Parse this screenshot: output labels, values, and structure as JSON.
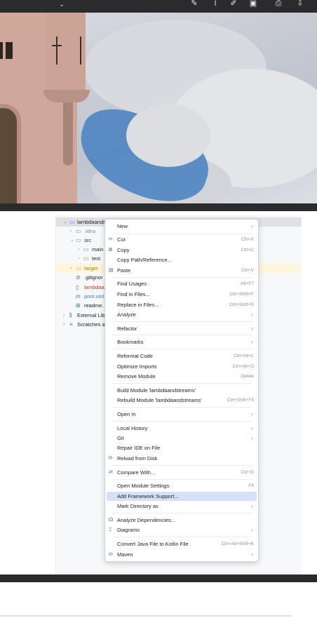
{
  "viewer_toolbar": {
    "tools": [
      "highlight-icon",
      "text-icon",
      "draw-icon",
      "image-icon",
      "print-icon",
      "save-icon"
    ]
  },
  "project_tree": {
    "rows": [
      {
        "label": "lambdaands"
      },
      {
        "label": ".idea"
      },
      {
        "label": "src"
      },
      {
        "label": "main"
      },
      {
        "label": "test"
      },
      {
        "label": "target"
      },
      {
        "label": ".gitignor"
      },
      {
        "label": "lambdaa"
      },
      {
        "label": "pom.xml"
      },
      {
        "label": "readme."
      },
      {
        "label": "External Libr"
      },
      {
        "label": "Scratches a"
      }
    ]
  },
  "context_menu": {
    "items": {
      "new": {
        "label": "New"
      },
      "cut": {
        "label": "Cut",
        "shortcut": "Ctrl+X"
      },
      "copy": {
        "label": "Copy",
        "shortcut": "Ctrl+C"
      },
      "copy_path": {
        "label": "Copy Path/Reference..."
      },
      "paste": {
        "label": "Paste",
        "shortcut": "Ctrl+V"
      },
      "find_usages": {
        "label": "Find Usages",
        "shortcut": "Alt+F7"
      },
      "find_in_files": {
        "label": "Find in Files...",
        "shortcut": "Ctrl+Shift+F"
      },
      "replace_in_files": {
        "label": "Replace in Files...",
        "shortcut": "Ctrl+Shift+R"
      },
      "analyze": {
        "label": "Analyze"
      },
      "refactor": {
        "label": "Refactor"
      },
      "bookmarks": {
        "label": "Bookmarks"
      },
      "reformat_code": {
        "label": "Reformat Code",
        "shortcut": "Ctrl+Alt+L"
      },
      "optimize_imports": {
        "label": "Optimize Imports",
        "shortcut": "Ctrl+Alt+O"
      },
      "remove_module": {
        "label": "Remove Module",
        "shortcut": "Delete"
      },
      "build_module": {
        "label": "Build Module 'lambdaandstreams'"
      },
      "rebuild_module": {
        "label": "Rebuild Module 'lambdaandstreams'",
        "shortcut": "Ctrl+Shift+F9"
      },
      "open_in": {
        "label": "Open In"
      },
      "local_history": {
        "label": "Local History"
      },
      "git": {
        "label": "Git"
      },
      "repair_ide": {
        "label": "Repair IDE on File"
      },
      "reload_from_disk": {
        "label": "Reload from Disk"
      },
      "compare_with": {
        "label": "Compare With...",
        "shortcut": "Ctrl+D"
      },
      "open_module_settings": {
        "label": "Open Module Settings",
        "shortcut": "F4"
      },
      "add_framework_support": {
        "label": "Add Framework Support..."
      },
      "mark_directory_as": {
        "label": "Mark Directory as"
      },
      "analyze_dependencies": {
        "label": "Analyze Dependencies..."
      },
      "diagrams": {
        "label": "Diagrams"
      },
      "convert_java_kotlin": {
        "label": "Convert Java File to Kotlin File",
        "shortcut": "Ctrl+Alt+Shift+K"
      },
      "maven": {
        "label": "Maven"
      }
    },
    "submenu_glyph": "›",
    "active_item": "Add Framework Support...",
    "colors": {
      "highlight": "#d5e1f9",
      "shortcut_text": "#8c8f97"
    }
  }
}
